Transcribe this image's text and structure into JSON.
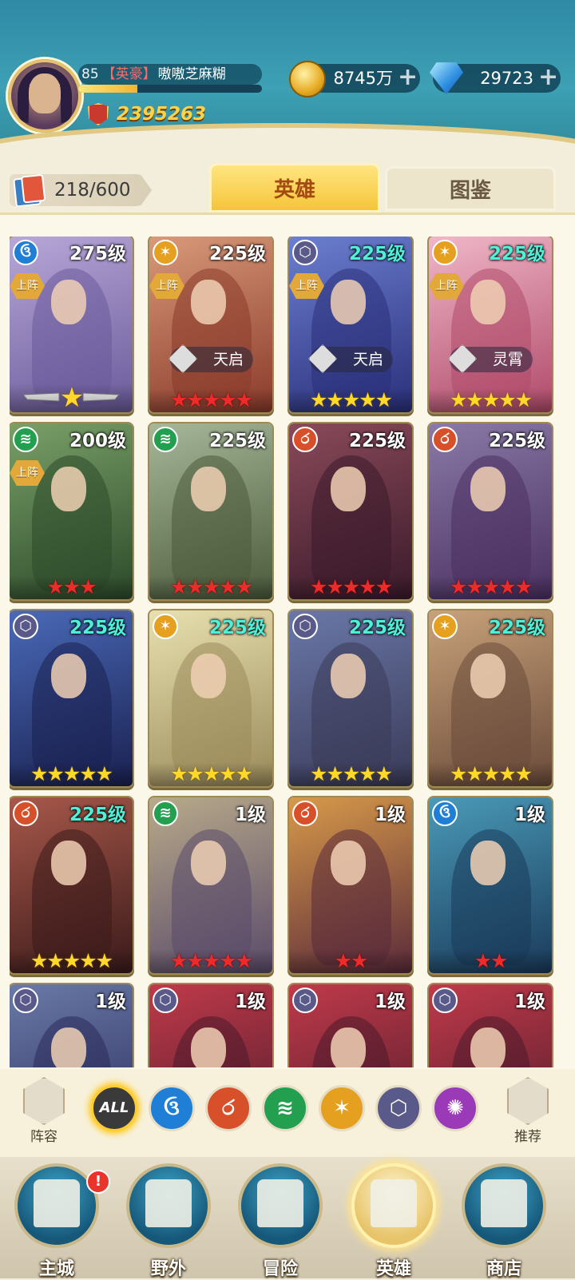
{
  "header": {
    "level": "85",
    "title_tag": "【英豪】",
    "player_name": "嗷嗷芝麻糊",
    "xp_fraction": 0.32,
    "power": "2395263",
    "coins": "8745万",
    "gems": "29723"
  },
  "tabs": {
    "count": "218/600",
    "heroes": "英雄",
    "codex": "图鉴"
  },
  "heroes": [
    {
      "level": "275级",
      "level_color": "white",
      "element": "water",
      "badge": "上阵",
      "rank": "",
      "stars": "★",
      "star_color": "gold",
      "wings": true,
      "art": [
        "#b8a7d8",
        "#6a5a9a"
      ]
    },
    {
      "level": "225级",
      "level_color": "white",
      "element": "light",
      "badge": "上阵",
      "rank": "天启",
      "stars": "★★★★★",
      "star_color": "red",
      "wings": false,
      "art": [
        "#d99a7a",
        "#8a3a2a"
      ]
    },
    {
      "level": "225级",
      "level_color": "cyan",
      "element": "dark",
      "badge": "上阵",
      "rank": "天启",
      "stars": "★★★★★",
      "star_color": "gold",
      "wings": false,
      "art": [
        "#6c7fd0",
        "#2a2f7a"
      ]
    },
    {
      "level": "225级",
      "level_color": "cyan",
      "element": "light",
      "badge": "上阵",
      "rank": "灵霄",
      "stars": "★★★★★",
      "star_color": "gold",
      "wings": false,
      "art": [
        "#f0b7c8",
        "#b04a6a"
      ]
    },
    {
      "level": "200级",
      "level_color": "white",
      "element": "wind",
      "badge": "上阵",
      "rank": "",
      "stars": "★★★",
      "star_color": "red",
      "wings": false,
      "art": [
        "#7aa068",
        "#2c4a2a"
      ]
    },
    {
      "level": "225级",
      "level_color": "white",
      "element": "wind",
      "badge": "",
      "rank": "",
      "stars": "★★★★★",
      "star_color": "red",
      "wings": false,
      "art": [
        "#a7b89a",
        "#4a5a3a"
      ]
    },
    {
      "level": "225级",
      "level_color": "white",
      "element": "fire",
      "badge": "",
      "rank": "",
      "stars": "★★★★★",
      "star_color": "red",
      "wings": false,
      "art": [
        "#8a4a5a",
        "#3a1a2a"
      ]
    },
    {
      "level": "225级",
      "level_color": "white",
      "element": "fire",
      "badge": "",
      "rank": "",
      "stars": "★★★★★",
      "star_color": "red",
      "wings": false,
      "art": [
        "#8a7aa8",
        "#4a3060"
      ]
    },
    {
      "level": "225级",
      "level_color": "cyan",
      "element": "dark",
      "badge": "",
      "rank": "",
      "stars": "★★★★★",
      "star_color": "gold",
      "wings": false,
      "art": [
        "#4a6ab8",
        "#1a2050"
      ]
    },
    {
      "level": "225级",
      "level_color": "cyan",
      "element": "light",
      "badge": "",
      "rank": "",
      "stars": "★★★★★",
      "star_color": "gold",
      "wings": false,
      "art": [
        "#e8e0b0",
        "#9a8a5a"
      ]
    },
    {
      "level": "225级",
      "level_color": "cyan",
      "element": "dark",
      "badge": "",
      "rank": "",
      "stars": "★★★★★",
      "star_color": "gold",
      "wings": false,
      "art": [
        "#6a78a8",
        "#3a3a58"
      ]
    },
    {
      "level": "225级",
      "level_color": "cyan",
      "element": "light",
      "badge": "",
      "rank": "",
      "stars": "★★★★★",
      "star_color": "gold",
      "wings": false,
      "art": [
        "#c8a27a",
        "#6a4a3a"
      ]
    },
    {
      "level": "225级",
      "level_color": "cyan",
      "element": "fire",
      "badge": "",
      "rank": "",
      "stars": "★★★★★",
      "star_color": "gold",
      "wings": false,
      "art": [
        "#a8584a",
        "#3a1a1a"
      ]
    },
    {
      "level": "1级",
      "level_color": "white",
      "element": "wind",
      "badge": "",
      "rank": "",
      "stars": "★★★★★",
      "star_color": "red",
      "wings": false,
      "art": [
        "#b8aa8a",
        "#5a4a6a"
      ]
    },
    {
      "level": "1级",
      "level_color": "white",
      "element": "fire",
      "badge": "",
      "rank": "",
      "stars": "★★",
      "star_color": "red",
      "wings": false,
      "art": [
        "#d89a4a",
        "#5a2a3a"
      ]
    },
    {
      "level": "1级",
      "level_color": "white",
      "element": "water",
      "badge": "",
      "rank": "",
      "stars": "★★",
      "star_color": "red",
      "wings": false,
      "art": [
        "#4a9ab8",
        "#1a3a5a"
      ]
    },
    {
      "level": "1级",
      "level_color": "white",
      "element": "dark",
      "badge": "",
      "rank": "",
      "stars": "",
      "star_color": "red",
      "wings": false,
      "art": [
        "#6a7aa8",
        "#2a2a5a"
      ]
    },
    {
      "level": "1级",
      "level_color": "white",
      "element": "dark",
      "badge": "",
      "rank": "",
      "stars": "",
      "star_color": "red",
      "wings": false,
      "art": [
        "#c03a4a",
        "#4a1a2a"
      ]
    },
    {
      "level": "1级",
      "level_color": "white",
      "element": "dark",
      "badge": "",
      "rank": "",
      "stars": "",
      "star_color": "red",
      "wings": false,
      "art": [
        "#c03a4a",
        "#4a1a2a"
      ]
    },
    {
      "level": "1级",
      "level_color": "white",
      "element": "dark",
      "badge": "",
      "rank": "",
      "stars": "",
      "star_color": "red",
      "wings": false,
      "art": [
        "#c03a4a",
        "#4a1a2a"
      ]
    }
  ],
  "element_colors": {
    "water": "#1f7fd6",
    "light": "#e6a020",
    "dark": "#5a5a8a",
    "wind": "#22a050",
    "fire": "#d8502a",
    "chaos": "#9a3ab8"
  },
  "filters": {
    "lineup": "阵容",
    "recommend": "推荐",
    "all": "ALL",
    "items": [
      "water",
      "fire",
      "wind",
      "light",
      "dark",
      "chaos"
    ]
  },
  "nav": [
    {
      "label": "主城",
      "alert": "!"
    },
    {
      "label": "野外",
      "alert": ""
    },
    {
      "label": "冒险",
      "alert": ""
    },
    {
      "label": "英雄",
      "alert": ""
    },
    {
      "label": "商店",
      "alert": ""
    }
  ]
}
